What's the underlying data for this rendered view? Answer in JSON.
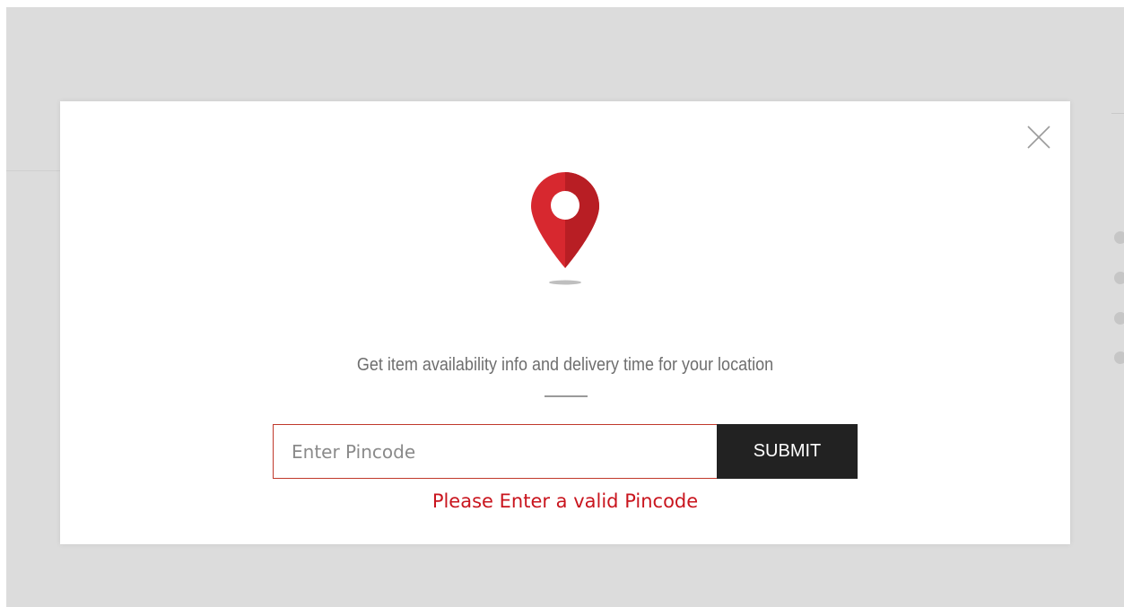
{
  "modal": {
    "headline": "Get item availability info and delivery time for your location",
    "close_icon": "close-icon",
    "pin_icon": "location-pin-icon",
    "pincode_input": {
      "value": "",
      "placeholder": "Enter Pincode"
    },
    "submit_label": "SUBMIT",
    "error_message": "Please Enter a valid Pincode"
  },
  "colors": {
    "accent": "#d7282f",
    "error": "#c9151e",
    "button_bg": "#222222",
    "overlay": "#dcdcdc"
  }
}
